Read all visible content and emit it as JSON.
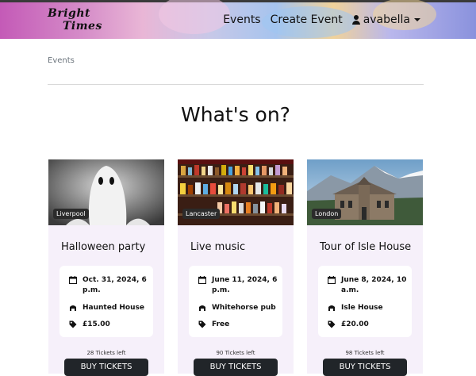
{
  "brand": {
    "line1": "Bright",
    "line2": "Times"
  },
  "nav": {
    "events": "Events",
    "create_event": "Create Event",
    "username": "avabella"
  },
  "breadcrumb": "Events",
  "page_title": "What's on?",
  "colors": {
    "card_bg": "#f6f0fa",
    "button_bg": "#212529",
    "badge_bg": "#2b2b2b"
  },
  "events": [
    {
      "location": "Liverpool",
      "title": "Halloween party",
      "date": "Oct. 31, 2024, 6 p.m.",
      "venue": "Haunted House",
      "price": "£15.00",
      "tickets_left": "28 Tickets left",
      "button": "BUY TICKETS"
    },
    {
      "location": "Lancaster",
      "title": "Live music",
      "date": "June 11, 2024, 6 p.m.",
      "venue": "Whitehorse pub",
      "price": "Free",
      "tickets_left": "90 Tickets left",
      "button": "BUY TICKETS"
    },
    {
      "location": "London",
      "title": "Tour of Isle House",
      "date": "June 8, 2024, 10 a.m.",
      "venue": "Isle House",
      "price": "£20.00",
      "tickets_left": "98 Tickets left",
      "button": "BUY TICKETS"
    }
  ]
}
